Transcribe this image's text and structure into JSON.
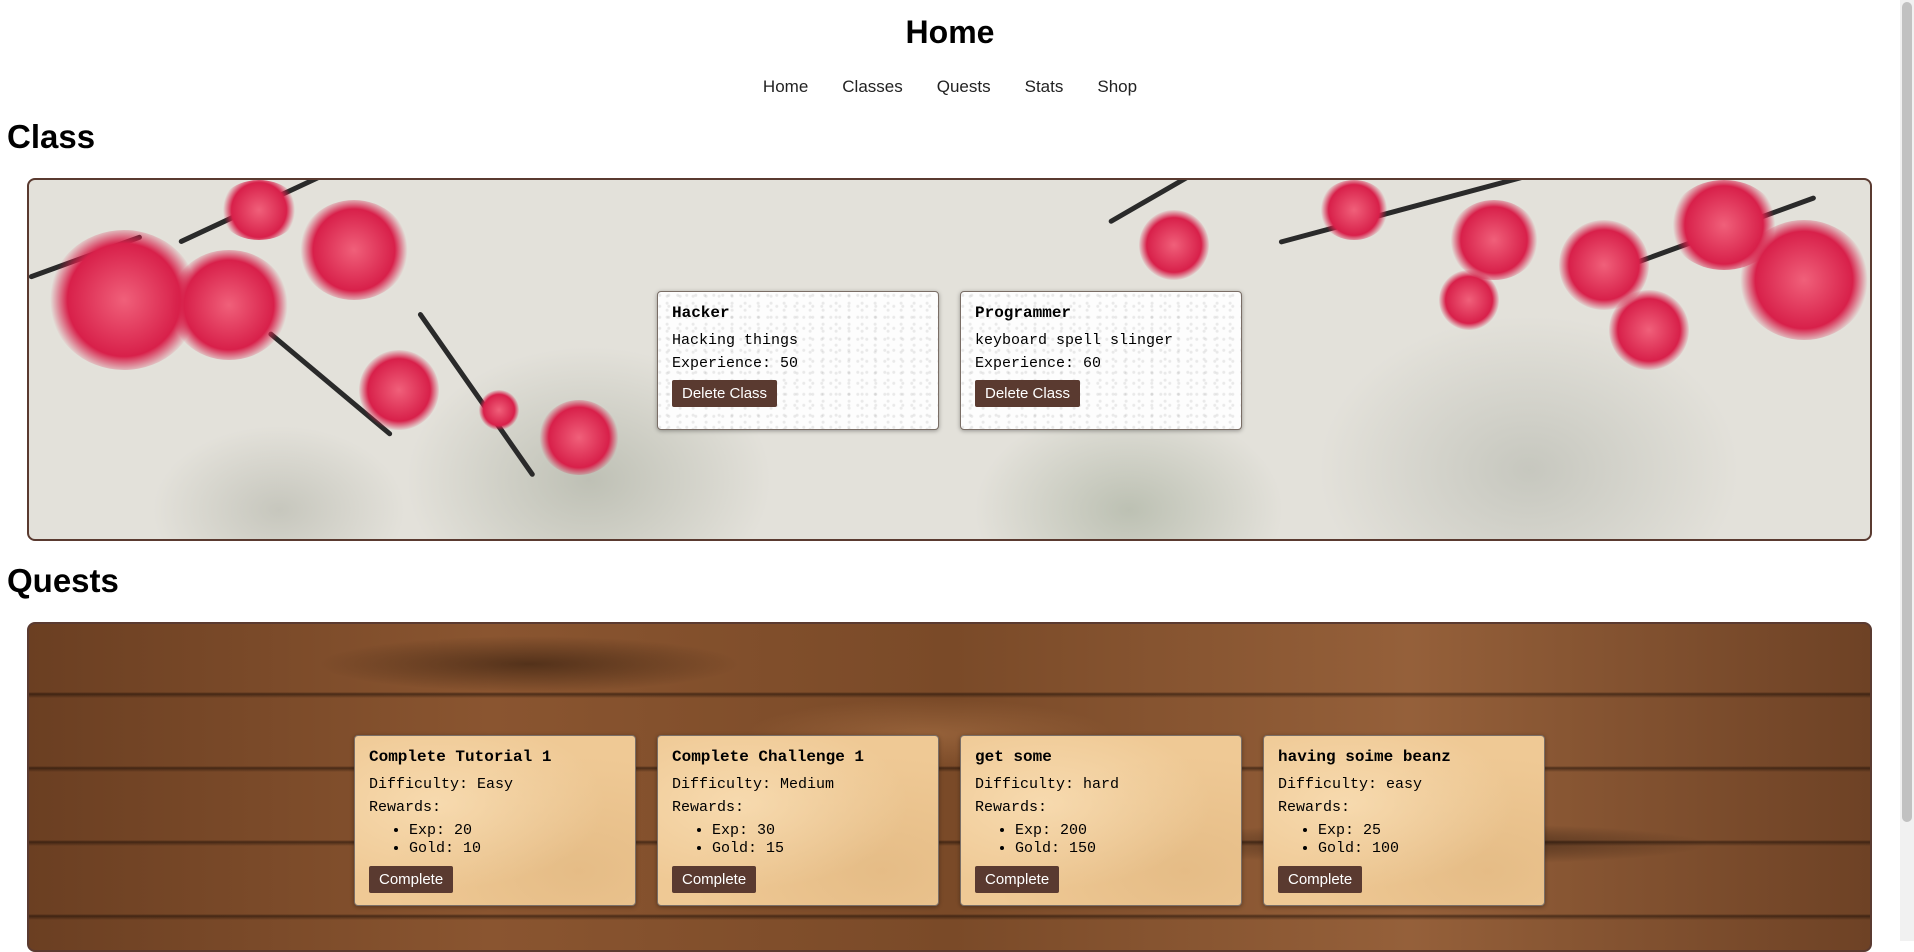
{
  "page": {
    "title": "Home"
  },
  "nav": {
    "items": [
      "Home",
      "Classes",
      "Quests",
      "Stats",
      "Shop"
    ]
  },
  "class_section": {
    "heading": "Class",
    "cards": [
      {
        "name": "Hacker",
        "description": "Hacking things",
        "experience": "Experience: 50",
        "button": "Delete Class"
      },
      {
        "name": "Programmer",
        "description": "keyboard spell slinger",
        "experience": "Experience: 60",
        "button": "Delete Class"
      }
    ]
  },
  "quest_section": {
    "heading": "Quests",
    "rewards_label": "Rewards:",
    "cards": [
      {
        "name": "Complete Tutorial 1",
        "difficulty": "Difficulty: Easy",
        "exp": "Exp: 20",
        "gold": "Gold: 10",
        "button": "Complete"
      },
      {
        "name": "Complete Challenge 1",
        "difficulty": "Difficulty: Medium",
        "exp": "Exp: 30",
        "gold": "Gold: 15",
        "button": "Complete"
      },
      {
        "name": "get some",
        "difficulty": "Difficulty: hard",
        "exp": "Exp: 200",
        "gold": "Gold: 150",
        "button": "Complete"
      },
      {
        "name": "having soime beanz",
        "difficulty": "Difficulty: easy",
        "exp": "Exp: 25",
        "gold": "Gold: 100",
        "button": "Complete"
      }
    ]
  },
  "colors": {
    "accent": "#5a3a30",
    "quest_card": "#efc995",
    "class_card": "#fdfdfd"
  }
}
